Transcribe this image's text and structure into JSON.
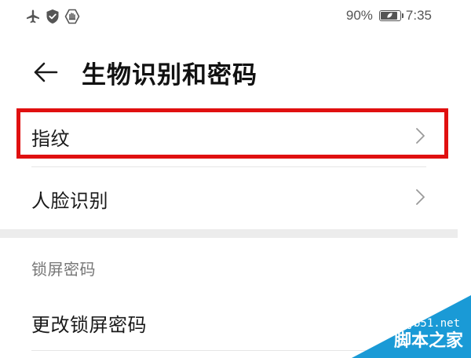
{
  "status_bar": {
    "icons": [
      "airplane-icon",
      "shield-icon",
      "hand-icon"
    ],
    "battery_percent_text": "90%",
    "battery_level": 0.9,
    "time": "7:35"
  },
  "header": {
    "back_icon": "arrow-left-icon",
    "title": "生物识别和密码"
  },
  "items": [
    {
      "label": "指纹",
      "icon": "chevron-right-icon",
      "highlighted": true
    },
    {
      "label": "人脸识别",
      "icon": "chevron-right-icon",
      "highlighted": false
    }
  ],
  "lock_section": {
    "header": "锁屏密码",
    "items": [
      {
        "label": "更改锁屏密码"
      }
    ]
  },
  "watermark": {
    "site": "jb51.net",
    "name": "脚本之家",
    "color": "#1a9ad6"
  },
  "colors": {
    "highlight_border": "#e01010",
    "section_gap": "#ececec",
    "divider": "#e6e6e6"
  }
}
